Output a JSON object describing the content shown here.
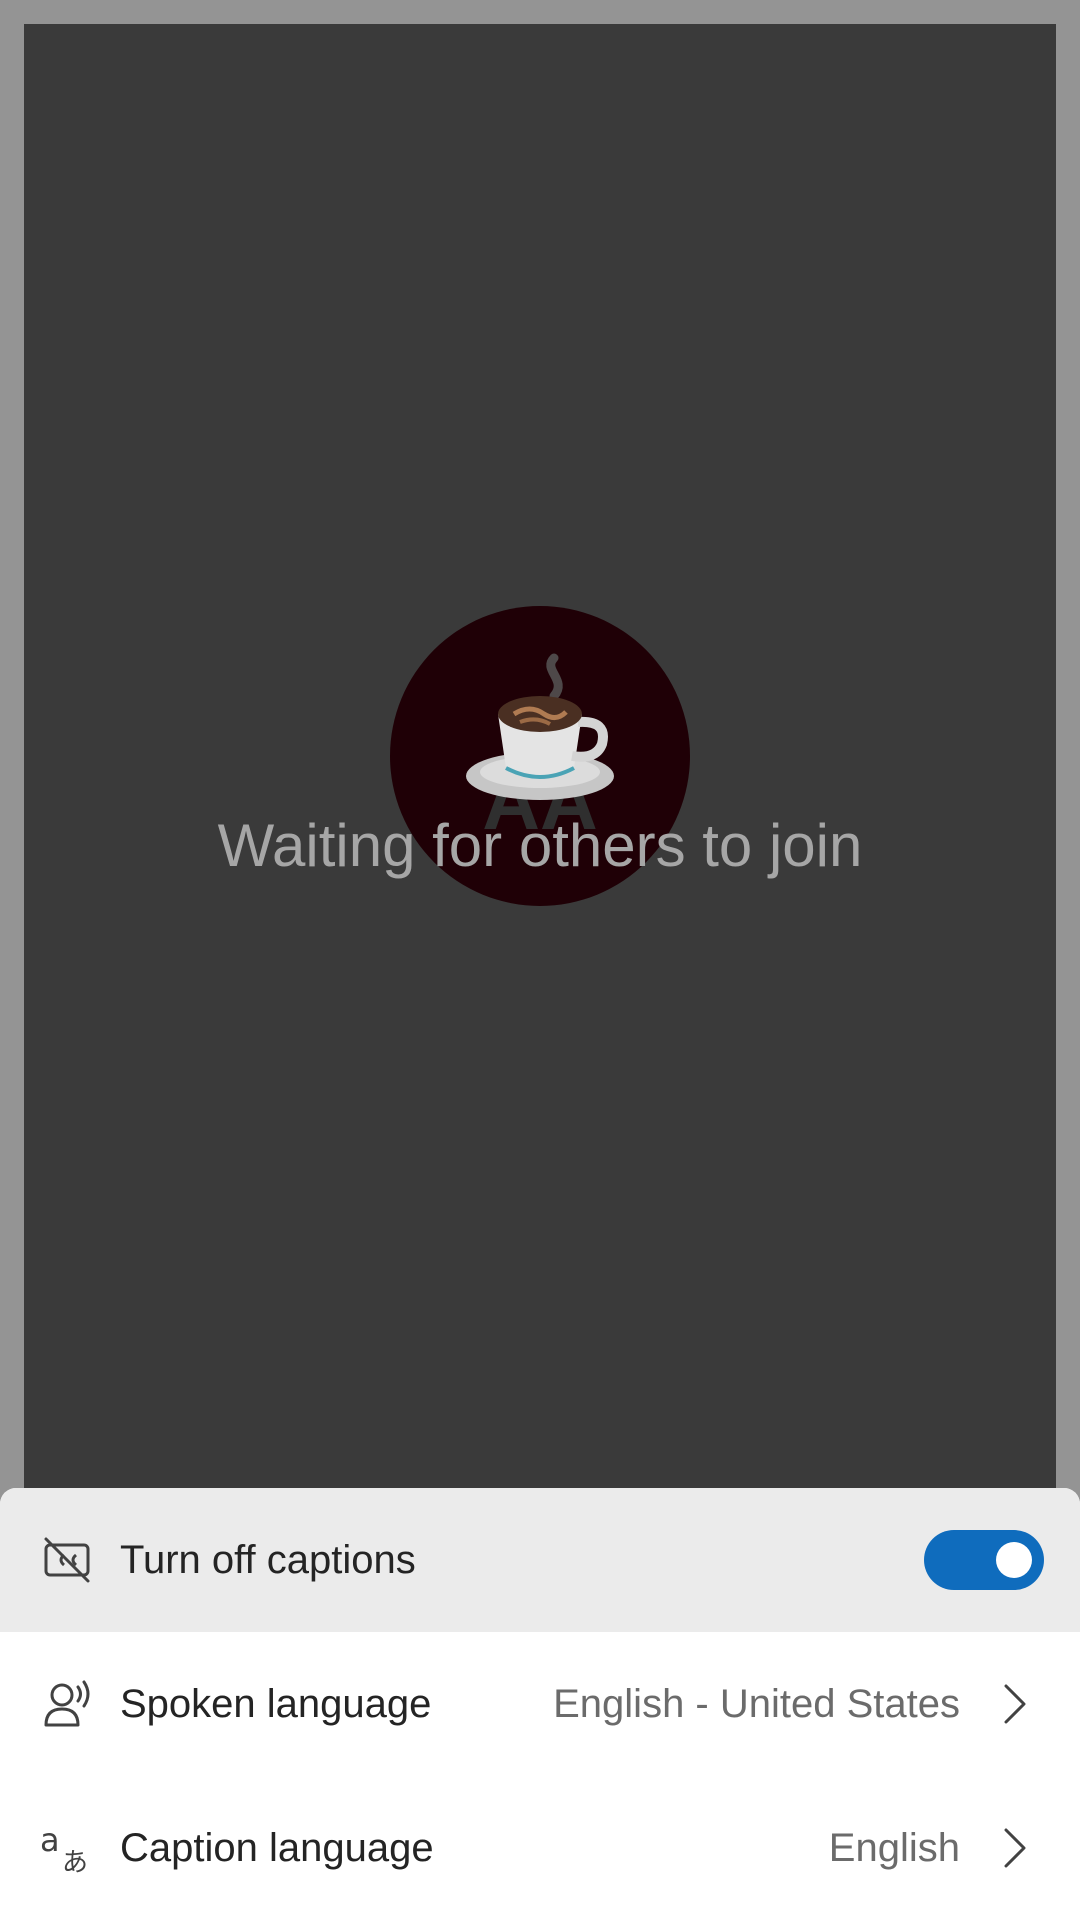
{
  "call": {
    "avatar_initials": "AA",
    "status_text": "Waiting for others to join",
    "avatar_icon": "coffee-cup-icon"
  },
  "captions_menu": {
    "turn_off": {
      "label": "Turn off captions",
      "icon": "captions-off-icon",
      "toggle_on": true,
      "accent_color": "#0f6cbd"
    },
    "spoken_language": {
      "label": "Spoken language",
      "value": "English - United States",
      "icon": "person-voice-icon"
    },
    "caption_language": {
      "label": "Caption language",
      "value": "English",
      "icon": "translate-icon"
    }
  }
}
